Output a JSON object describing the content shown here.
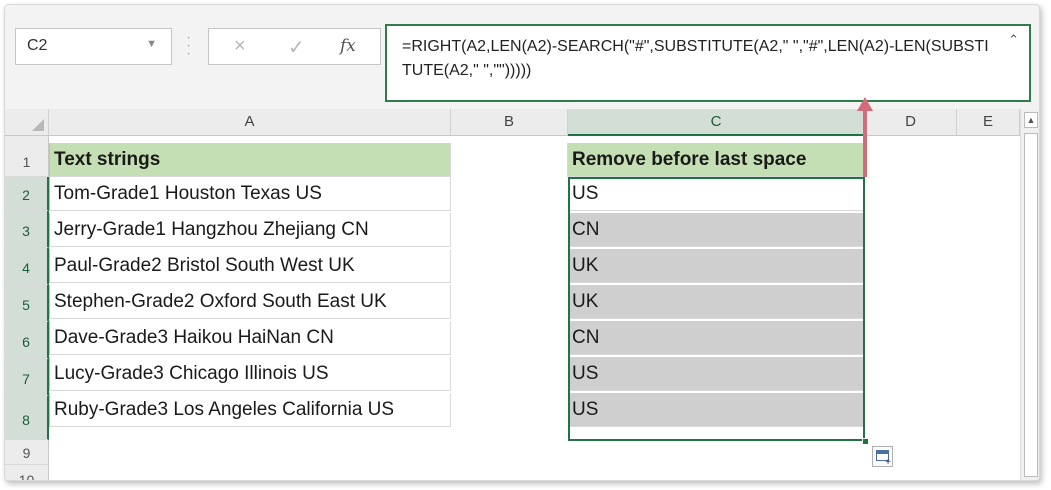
{
  "formula_bar": {
    "name_box": "C2",
    "cancel_icon": "×",
    "enter_icon": "✓",
    "fx_label": "fx",
    "formula": "=RIGHT(A2,LEN(A2)-SEARCH(\"#\",SUBSTITUTE(A2,\" \",\"#\",LEN(A2)-LEN(SUBSTITUTE(A2,\" \",\"\")))))"
  },
  "columns": [
    "A",
    "B",
    "C",
    "D",
    "E"
  ],
  "rows": [
    "1",
    "2",
    "3",
    "4",
    "5",
    "6",
    "7",
    "8",
    "9",
    "10"
  ],
  "sheet": {
    "header_a": "Text strings",
    "header_c": "Remove before last space",
    "data": [
      {
        "a": "Tom-Grade1 Houston Texas US",
        "c": "US"
      },
      {
        "a": "Jerry-Grade1 Hangzhou Zhejiang CN",
        "c": "CN"
      },
      {
        "a": "Paul-Grade2 Bristol South West UK",
        "c": "UK"
      },
      {
        "a": "Stephen-Grade2 Oxford South East UK",
        "c": "UK"
      },
      {
        "a": "Dave-Grade3 Haikou HaiNan CN",
        "c": "CN"
      },
      {
        "a": "Lucy-Grade3 Chicago Illinois US",
        "c": "US"
      },
      {
        "a": "Ruby-Grade3 Los Angeles California US",
        "c": "US"
      }
    ]
  },
  "colors": {
    "header_fill": "#c5dfb4",
    "selection_border": "#217346",
    "shaded_cells": "#cfcfcf",
    "annotation_arrow": "#d36b79"
  },
  "icons": {
    "name_box_dropdown": "chevron-down-icon",
    "cancel": "close-icon",
    "enter": "check-icon",
    "insert_function": "fx-icon",
    "quick_analysis": "quick-analysis-icon",
    "annotation": "arrow-up-icon"
  }
}
